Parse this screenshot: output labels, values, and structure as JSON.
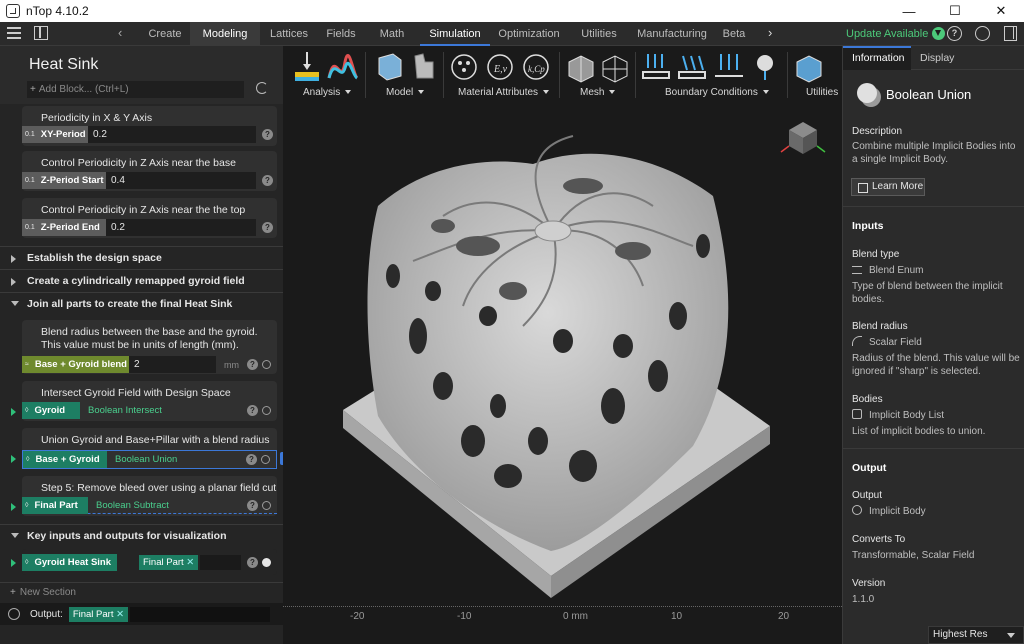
{
  "window": {
    "title": "nTop 4.10.2"
  },
  "menu_tabs": [
    "Create",
    "Modeling",
    "Lattices",
    "Fields",
    "Math",
    "Simulation",
    "Optimization",
    "Utilities",
    "Manufacturing",
    "Beta"
  ],
  "active_tab": "Modeling",
  "selected_tab": "Simulation",
  "update_label": "Update Available",
  "left": {
    "title": "Heat Sink",
    "add_placeholder": "Add Block... (Ctrl+L)",
    "cards": [
      {
        "caption": "Periodicity in X & Y Axis",
        "chip": "XY-Period",
        "value": "0.2"
      },
      {
        "caption": "Control Periodicity in Z Axis near the base",
        "chip": "Z-Period Start",
        "value": "0.4"
      },
      {
        "caption": "Control Periodicity in Z Axis near the the top",
        "chip": "Z-Period End",
        "value": "0.2"
      }
    ],
    "sections": [
      "Establish the design space",
      "Create a cylindrically remapped gyroid field",
      "Join all parts to create the final Heat Sink",
      "Key inputs and outputs for visualization"
    ],
    "blend_card": {
      "caption": "Blend radius between the base and the gyroid. This value must be in units of length (mm).",
      "chip": "Base + Gyroid blend",
      "value": "2",
      "unit": "mm"
    },
    "op_cards": [
      {
        "caption": "Intersect Gyroid Field with Design Space",
        "chip": "Gyroid",
        "type": "Boolean Intersect"
      },
      {
        "caption": "Union Gyroid and Base+Pillar with a blend radius",
        "chip": "Base + Gyroid",
        "type": "Boolean Union"
      },
      {
        "caption": "Step 5: Remove bleed over using a planar field cut",
        "chip": "Final Part",
        "type": "Boolean Subtract"
      }
    ],
    "key_io": {
      "chip": "Gyroid Heat Sink",
      "value": "Final Part"
    },
    "new_section": "New Section",
    "output_label": "Output:",
    "output_value": "Final Part",
    "chip_prefix": "0.1"
  },
  "toolbar": {
    "groups": [
      "Analysis",
      "Model",
      "Material Attributes",
      "Mesh",
      "Boundary Conditions",
      "Utilities"
    ]
  },
  "viewport": {
    "ruler_labels": [
      "-20",
      "-10",
      "0 mm",
      "10",
      "20"
    ],
    "resolution": "Highest Res"
  },
  "right": {
    "tabs": [
      "Information",
      "Display"
    ],
    "block_name": "Boolean Union",
    "description_h": "Description",
    "description": "Combine multiple Implicit Bodies into a single Implicit Body.",
    "learn_more": "Learn More",
    "inputs_h": "Inputs",
    "inputs": [
      {
        "name": "Blend type",
        "type": "Blend Enum",
        "desc": "Type of blend between the implicit bodies."
      },
      {
        "name": "Blend radius",
        "type": "Scalar Field",
        "desc": "Radius of the blend. This value will be ignored if \"sharp\" is selected."
      },
      {
        "name": "Bodies",
        "type": "Implicit Body List",
        "desc": "List of implicit bodies to union."
      }
    ],
    "output_h": "Output",
    "output_name": "Output",
    "output_type": "Implicit Body",
    "converts_h": "Converts To",
    "converts": "Transformable, Scalar Field",
    "version_h": "Version",
    "version": "1.1.0"
  },
  "colors": {
    "accent_blue": "#3c78d8",
    "teal": "#1d7e63",
    "green_text": "#4ad08e",
    "olive": "#6f8a2e"
  }
}
